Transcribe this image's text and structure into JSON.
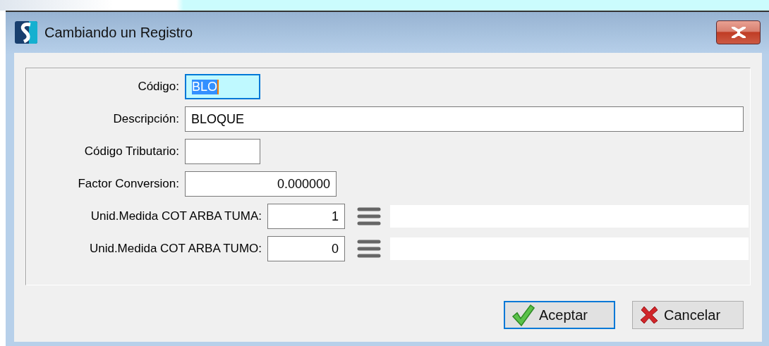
{
  "window": {
    "title": "Cambiando un Registro"
  },
  "fields": [
    {
      "kind": "code",
      "label": "Código:",
      "value": "BLO",
      "focused": true
    },
    {
      "kind": "text",
      "label": "Descripción:",
      "value": "BLOQUE",
      "focused": false
    },
    {
      "kind": "code",
      "label": "Código Tributario:",
      "focused": false
    },
    {
      "kind": "number",
      "label": "Factor Conversion:",
      "value": "0.000000",
      "focused": false
    },
    {
      "kind": "lookup",
      "label": "Unid.Medida COT ARBA TUMA:",
      "value": "1",
      "focused": false
    },
    {
      "kind": "lookup",
      "label": "Unid.Medida COT ARBA TUMO:",
      "value": "0",
      "focused": false
    }
  ],
  "buttons": [
    {
      "kind": "ok",
      "label": "Aceptar",
      "default": true
    },
    {
      "kind": "cancel",
      "label": "Cancelar",
      "default": false
    }
  ]
}
